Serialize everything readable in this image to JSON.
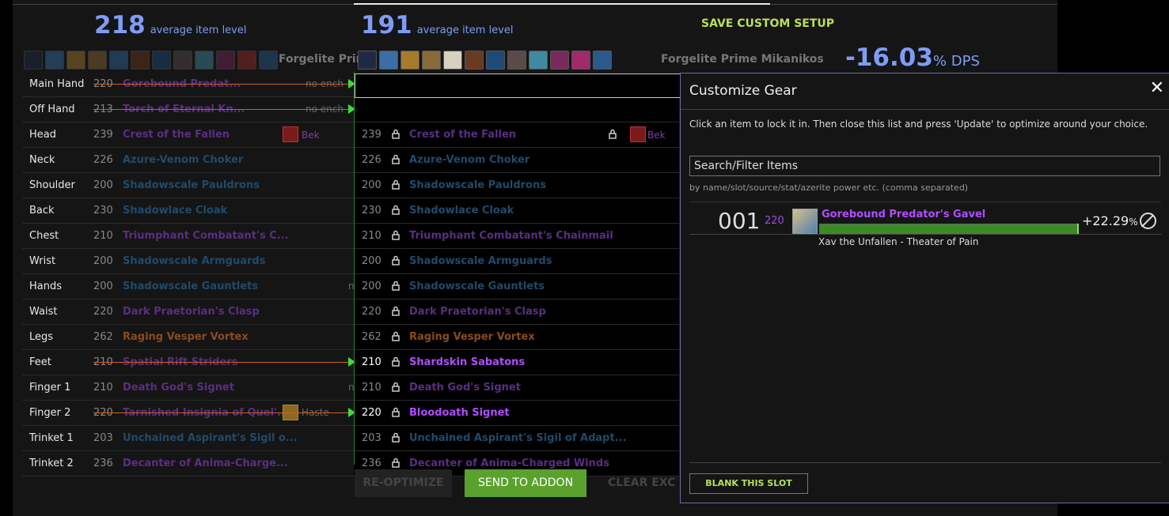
{
  "left": {
    "ilvl": "218",
    "ilvl_label": "average item level",
    "set_name": "Forgelite Prim"
  },
  "right": {
    "ilvl": "191",
    "ilvl_label": "average item level",
    "set_name": "Forgelite Prime Mikanikos"
  },
  "save_label": "SAVE CUSTOM SETUP",
  "dps": {
    "value": "-16.03",
    "unit": "% DPS"
  },
  "rows": [
    {
      "slot": "Main Hand",
      "lvl": "220",
      "name": "Gorebound Predat...",
      "ench": "no ench",
      "strike": true
    },
    {
      "slot": "Off Hand",
      "lvl": "213",
      "name": "Torch of Eternal Kn...",
      "ench": "no ench",
      "strike": true
    },
    {
      "slot": "Head",
      "lvl": "239",
      "name": "Crest of the Fallen",
      "ench": "Bek",
      "rlvl": "239",
      "rname": "Crest of the Fallen",
      "rench": "Bek"
    },
    {
      "slot": "Neck",
      "lvl": "226",
      "name": "Azure-Venom Choker",
      "rlvl": "226",
      "rname": "Azure-Venom Choker"
    },
    {
      "slot": "Shoulder",
      "lvl": "200",
      "name": "Shadowscale Pauldrons",
      "rlvl": "200",
      "rname": "Shadowscale Pauldrons"
    },
    {
      "slot": "Back",
      "lvl": "230",
      "name": "Shadowlace Cloak",
      "rlvl": "230",
      "rname": "Shadowlace Cloak"
    },
    {
      "slot": "Chest",
      "lvl": "210",
      "name": "Triumphant Combatant's C...",
      "rlvl": "210",
      "rname": "Triumphant Combatant's Chainmail"
    },
    {
      "slot": "Wrist",
      "lvl": "200",
      "name": "Shadowscale Armguards",
      "rlvl": "200",
      "rname": "Shadowscale Armguards"
    },
    {
      "slot": "Hands",
      "lvl": "200",
      "name": "Shadowscale Gauntlets",
      "ench": "n",
      "rlvl": "200",
      "rname": "Shadowscale Gauntlets"
    },
    {
      "slot": "Waist",
      "lvl": "220",
      "name": "Dark Praetorian's Clasp",
      "rlvl": "220",
      "rname": "Dark Praetorian's Clasp"
    },
    {
      "slot": "Legs",
      "lvl": "262",
      "name": "Raging Vesper Vortex",
      "rlvl": "262",
      "rname": "Raging Vesper Vortex"
    },
    {
      "slot": "Feet",
      "lvl": "210",
      "name": "Spatial Rift Striders",
      "strike": true,
      "rlvl": "210",
      "rname": "Shardskin Sabatons"
    },
    {
      "slot": "Finger 1",
      "lvl": "210",
      "name": "Death God's Signet",
      "ench": "n",
      "rlvl": "210",
      "rname": "Death God's Signet"
    },
    {
      "slot": "Finger 2",
      "lvl": "220",
      "name": "Tarnished Insignia of Quel'...",
      "ench": "Haste",
      "strike": true,
      "rlvl": "220",
      "rname": "Bloodoath Signet"
    },
    {
      "slot": "Trinket 1",
      "lvl": "203",
      "name": "Unchained Aspirant's Sigil o...",
      "rlvl": "203",
      "rname": "Unchained Aspirant's Sigil of Adapt..."
    },
    {
      "slot": "Trinket 2",
      "lvl": "236",
      "name": "Decanter of Anima-Charge...",
      "rlvl": "236",
      "rname": "Decanter of Anima-Charged Winds"
    }
  ],
  "buttons": {
    "reoptimize": "RE-OPTIMIZE",
    "send": "SEND TO ADDON",
    "clear": "CLEAR EXC"
  },
  "panel": {
    "title": "Customize Gear",
    "close": "✕",
    "info": "Click an item to lock it in. Then close this list and press 'Update' to optimize around your choice.",
    "search_placeholder": "Search/Filter Items",
    "hint": "by name/slot/source/stat/azerite power etc. (comma separated)",
    "result": {
      "rank": "001",
      "ilvl": "220",
      "name": "Gorebound Predator's Gavel",
      "gain": "+22.29",
      "gain_unit": "%",
      "source": "Xav the Unfallen - Theater of Pain"
    },
    "blank_label": "BLANK THIS SLOT"
  }
}
